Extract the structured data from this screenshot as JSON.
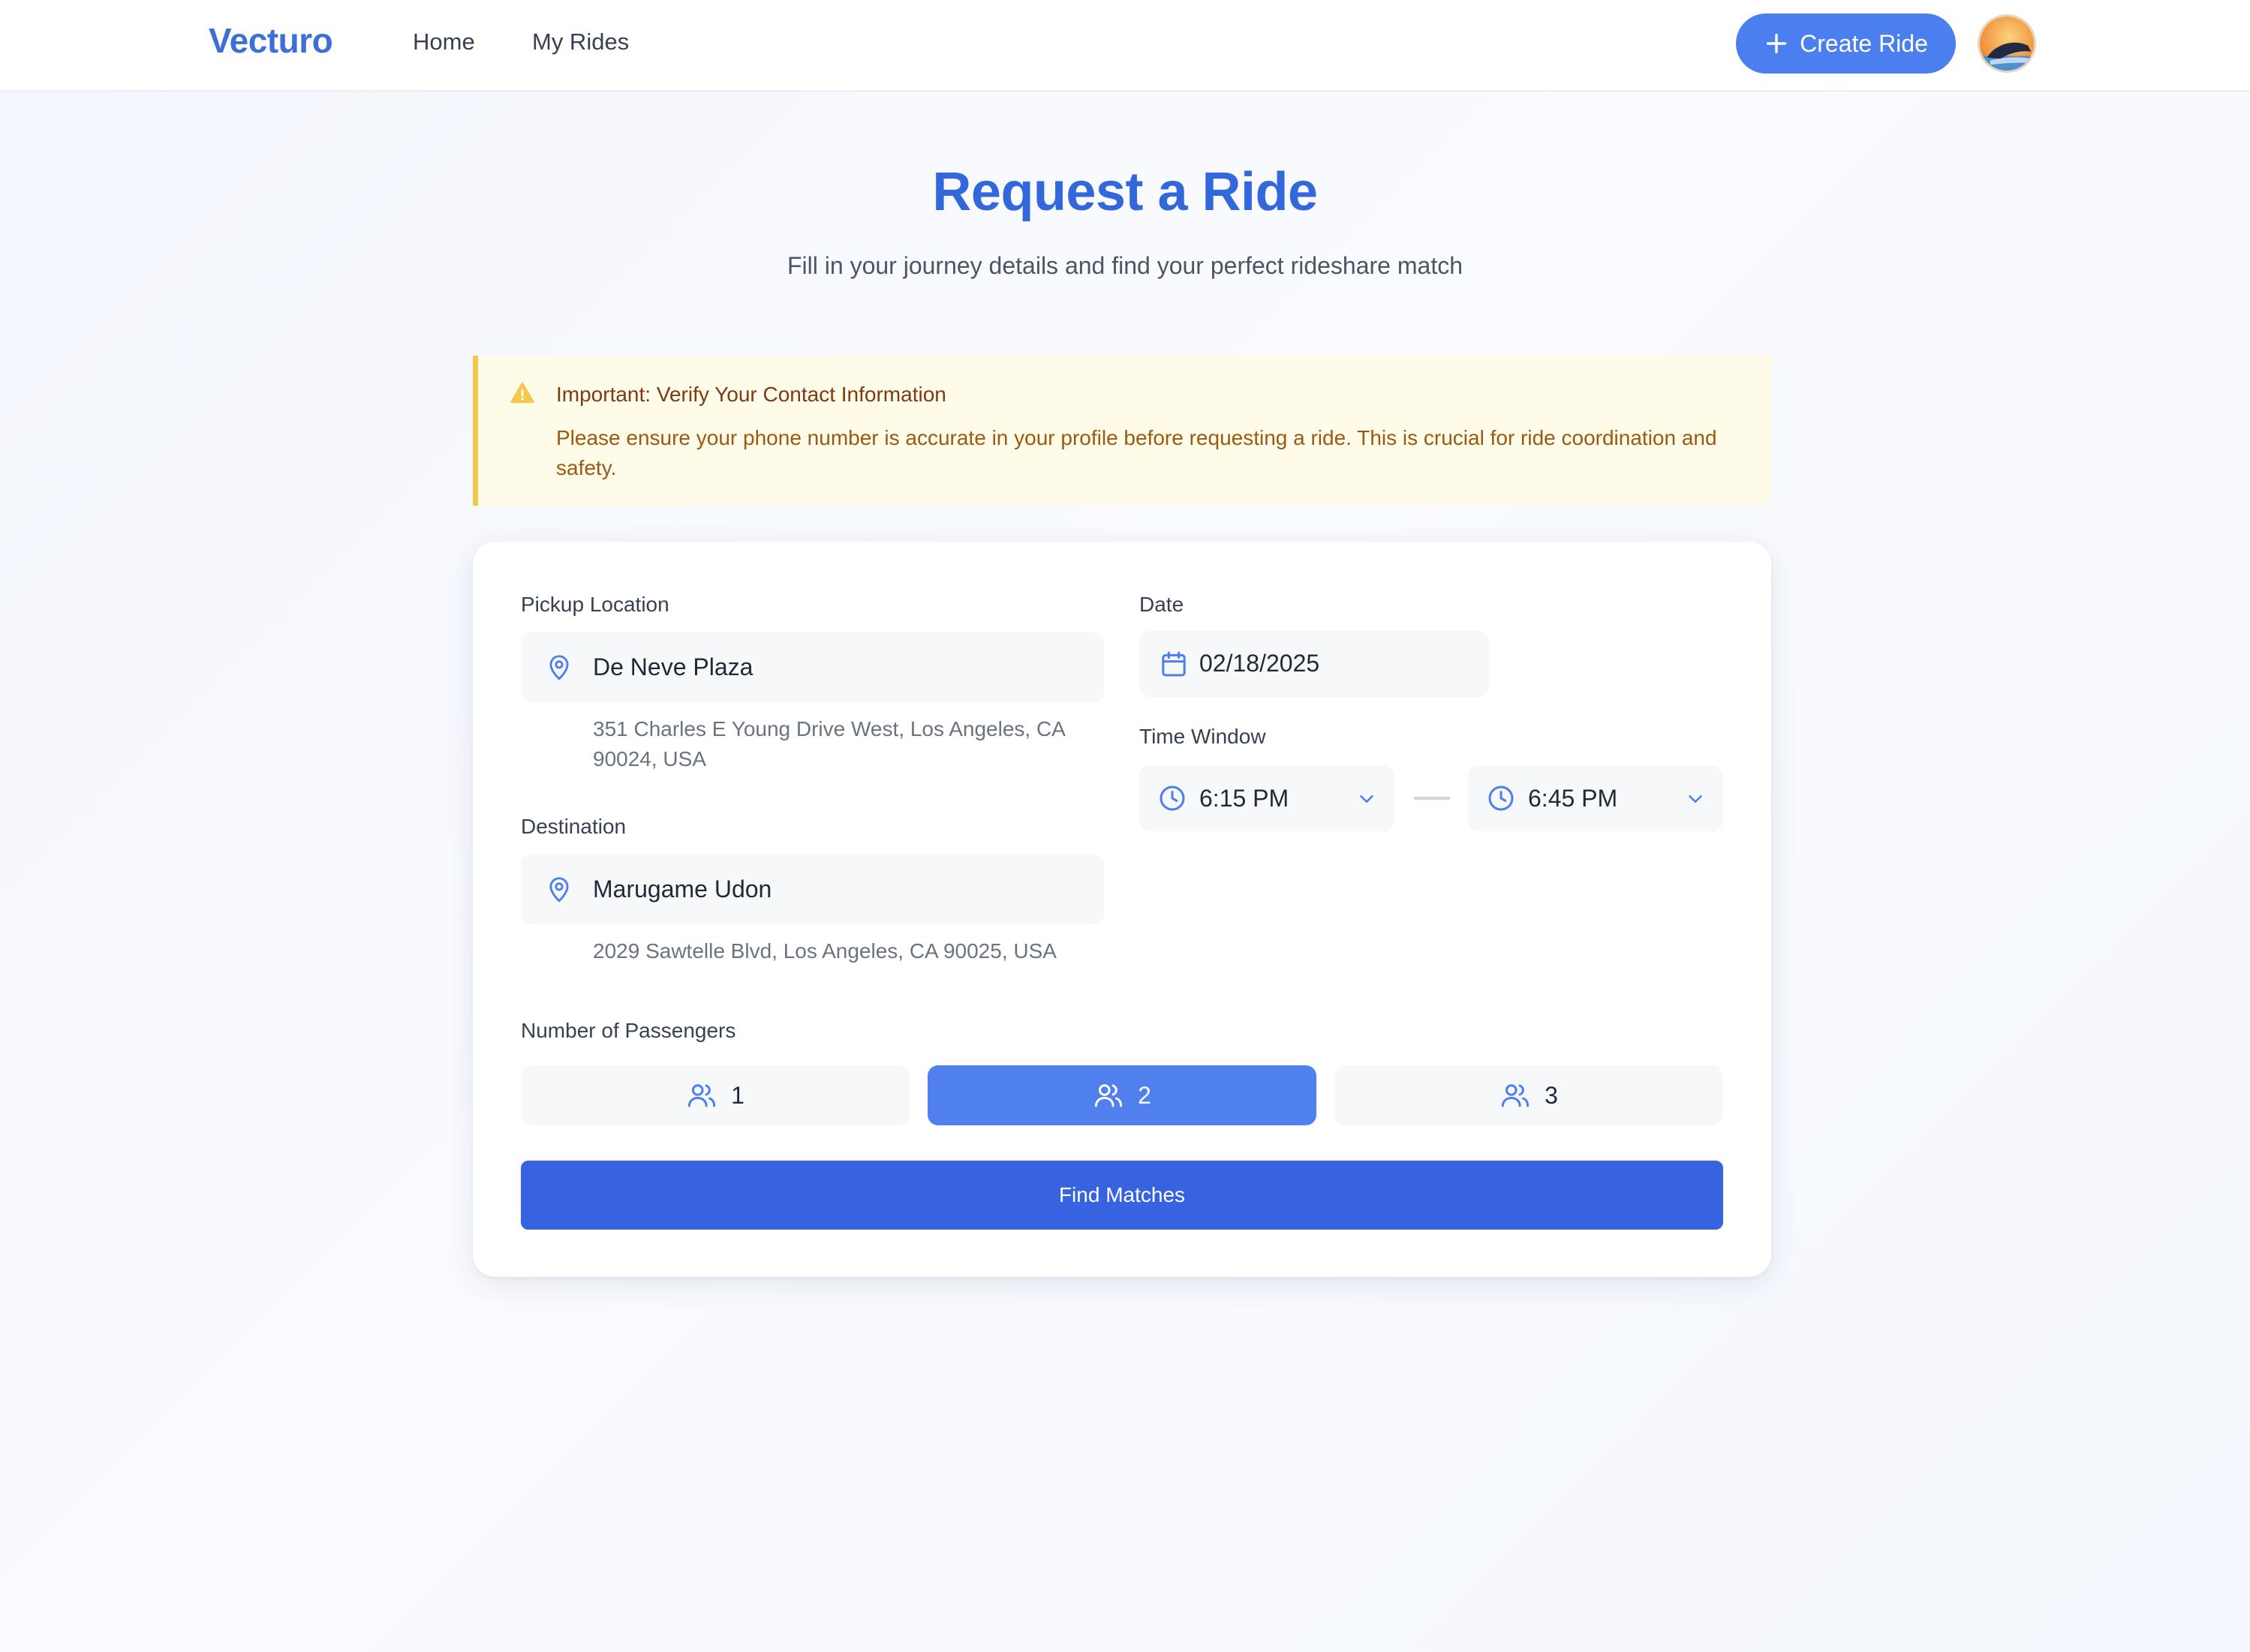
{
  "brand": "Vecturo",
  "nav": {
    "home": "Home",
    "my_rides": "My Rides",
    "create_ride": "Create Ride"
  },
  "page": {
    "title": "Request a Ride",
    "subtitle": "Fill in your journey details and find your perfect rideshare match"
  },
  "alert": {
    "title": "Important: Verify Your Contact Information",
    "text": "Please ensure your phone number is accurate in your profile before requesting a ride. This is crucial for ride coordination and safety.",
    "color": "#f2c94c"
  },
  "form": {
    "pickup": {
      "label": "Pickup Location",
      "name": "De Neve Plaza",
      "address": "351 Charles E Young Drive West, Los Angeles, CA 90024, USA"
    },
    "destination": {
      "label": "Destination",
      "name": "Marugame Udon",
      "address": "2029 Sawtelle Blvd, Los Angeles, CA 90025, USA"
    },
    "date": {
      "label": "Date",
      "value": "02/18/2025"
    },
    "time_window": {
      "label": "Time Window",
      "start": "6:15 PM",
      "end": "6:45 PM"
    },
    "passengers": {
      "label": "Number of Passengers",
      "options": [
        "1",
        "2",
        "3"
      ],
      "selected": "2"
    },
    "submit_label": "Find Matches"
  },
  "icons": {
    "create": "plus-icon",
    "location": "map-pin-icon",
    "date": "calendar-icon",
    "time": "clock-icon",
    "dropdown": "chevron-down-icon",
    "passengers": "users-icon",
    "alert": "warning-triangle-icon"
  },
  "colors": {
    "accent": "#3367dc",
    "primary_button": "#3763e0",
    "selected_option": "#4f80ee",
    "alert_border": "#f2c94c"
  }
}
